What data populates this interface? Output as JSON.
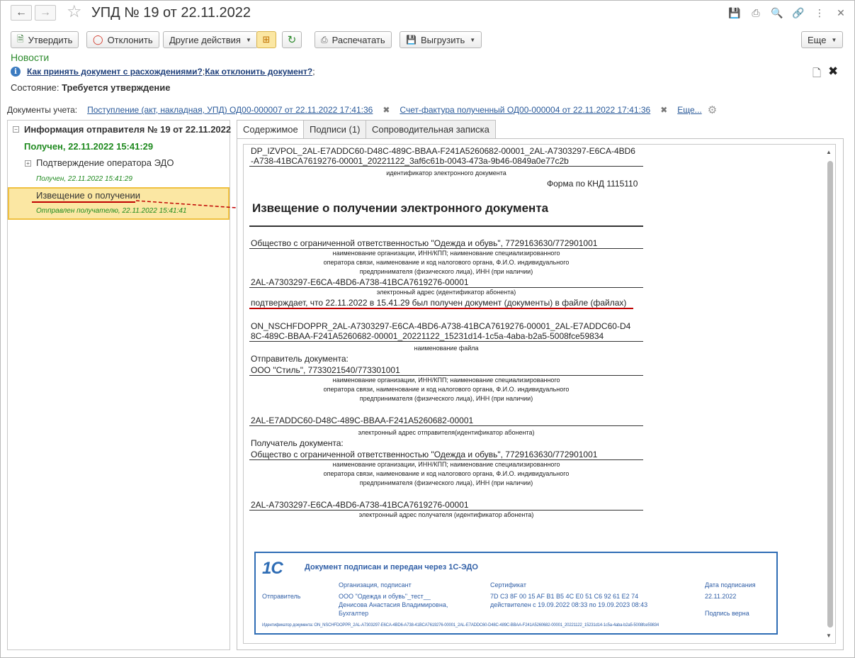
{
  "window": {
    "title": "УПД № 19 от 22.11.2022"
  },
  "toolbar": {
    "approve": "Утвердить",
    "reject": "Отклонить",
    "other_actions": "Другие действия",
    "print": "Распечатать",
    "export": "Выгрузить",
    "more": "Еще"
  },
  "news_label": "Новости",
  "info": {
    "link1": "Как принять документ с расхождениями?",
    "sep": ";",
    "link2": "Как отклонить документ?",
    "sep2": ";"
  },
  "state": {
    "label": "Состояние:",
    "value": "Требуется утверждение"
  },
  "docs": {
    "label": "Документы учета:",
    "doc1": "Поступление (акт, накладная, УПД) ОД00-000007 от 22.11.2022 17:41:36",
    "doc2": "Счет-фактура полученный ОД00-000004 от 22.11.2022 17:41:36",
    "more": "Еще..."
  },
  "tree": {
    "root": "Информация отправителя № 19 от 22.11.2022",
    "root_status": "Получен, 22.11.2022 15:41:29",
    "item1": "Подтверждение оператора ЭДО",
    "item1_status": "Получен, 22.11.2022 15:41:29",
    "item2": "Извещение о получении",
    "item2_status": "Отправлен получателю, 22.11.2022 15:41:41"
  },
  "tabs": [
    "Содержимое",
    "Подписи (1)",
    "Сопроводительная записка"
  ],
  "document": {
    "id_line1": "DP_IZVPOL_2AL-E7ADDC60-D48C-489C-BBAA-F241A5260682-00001_2AL-A7303297-E6CA-4BD6",
    "id_line2": "-A738-41BCA7619276-00001_20221122_3af6c61b-0043-473a-9b46-0849a0e77c2b",
    "id_caption": "идентификатор электронного документа",
    "form": "Форма по КНД 1115110",
    "heading": "Извещение о получении электронного документа",
    "org1": "Общество с ограниченной ответственностью \"Одежда и обувь\", 7729163630/772901001",
    "org_caption1": "наименование организации, ИНН/КПП; наименование специализированного",
    "org_caption2": "оператора связи, наименование и код налогового органа, Ф.И.О. индивидуального",
    "org_caption3": "предпринимателя (физического лица), ИНН (при наличии)",
    "addr1": "2AL-A7303297-E6CA-4BD6-A738-41BCA7619276-00001",
    "addr_caption": "электронный адрес (идентификатор абонента)",
    "confirm": "подтверждает, что 22.11.2022 в 15.41.29 был получен документ (документы) в файле (файлах)",
    "file1": "ON_NSCHFDOPPR_2AL-A7303297-E6CA-4BD6-A738-41BCA7619276-00001_2AL-E7ADDC60-D4",
    "file2": "8C-489C-BBAA-F241A5260682-00001_20221122_15231d14-1c5a-4aba-b2a5-5008fce59834",
    "file_caption": "наименование файла",
    "sender_label": "Отправитель документа:",
    "sender": "ООО \"Стиль\", 7733021540/773301001",
    "sender_caption1": "наименование организации, ИНН/КПП; наименование специализированного",
    "sender_caption2": "оператора связи, наименование и код налогового органа, Ф.И.О. индивидуального",
    "sender_caption3": "предпринимателя (физического лица), ИНН (при наличии)",
    "sender_addr": "2AL-E7ADDC60-D48C-489C-BBAA-F241A5260682-00001",
    "sender_addr_caption": "электронный адрес отправителя(идентификатор абонента)",
    "recipient_label": "Получатель документа:",
    "recipient": "Общество с ограниченной ответственностью \"Одежда и обувь\", 7729163630/772901001",
    "recipient_caption1": "наименование организации, ИНН/КПП; наименование специализированного",
    "recipient_caption2": "оператора связи, наименование и код налогового органа, Ф.И.О. индивидуального",
    "recipient_caption3": "предпринимателя (физического лица), ИНН (при наличии)",
    "recipient_addr": "2AL-A7303297-E6CA-4BD6-A738-41BCA7619276-00001",
    "recipient_addr_caption": "электронный адрес получателя (идентификатор абонента)"
  },
  "stamp": {
    "logo": "1С",
    "title": "Документ подписан и передан через 1С-ЭДО",
    "col_org": "Организация, подписант",
    "col_cert": "Сертификат",
    "col_date": "Дата подписания",
    "row_label": "Отправитель",
    "org1": "ООО \"Одежда и обувь\"_тест__",
    "org2": "Денисова Анастасия Владимировна,",
    "org3": "Бухгалтер",
    "cert1": "7D C3 8F 00 15 AF B1 B5 4C E0 51 C6 92 61 E2 74",
    "cert2": "действителен с 19.09.2022 08:33 по 19.09.2023 08:43",
    "date": "22.11.2022",
    "valid": "Подпись верна",
    "doc_id": "Идентификатор документа: ON_NSCHFDOPPR_2AL-A7303297-E6CA-4BD6-A738-41BCA7619276-00001_2AL-E7ADDC60-D48C-489C-BBAA-F241A5260682-00001_20221122_15231d14-1c5a-4aba-b2a5-5008fce59834"
  },
  "colors": {
    "accent_blue": "#2f6db5",
    "status_green": "#2e8b2e",
    "highlight_yellow": "#fbe7a3",
    "annotation_red": "#c00000"
  }
}
